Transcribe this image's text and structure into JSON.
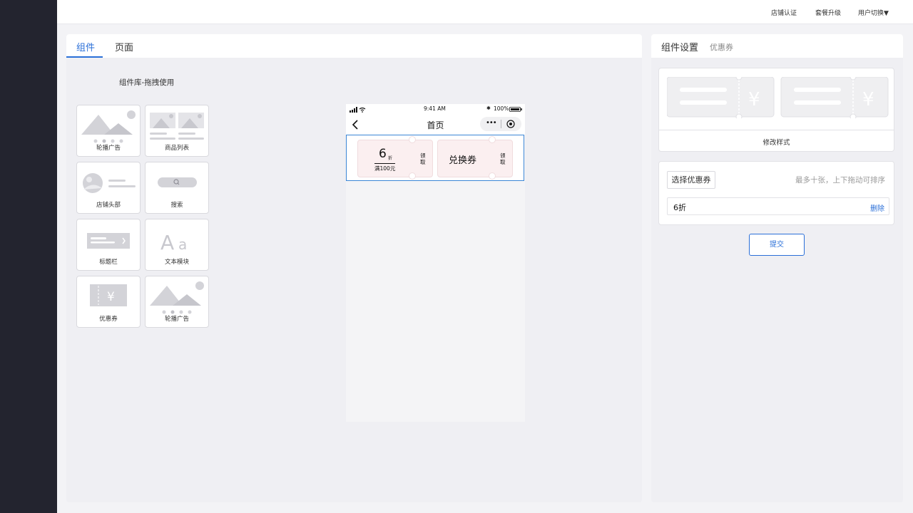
{
  "topbar": {
    "store_auth": "店铺认证",
    "plan_upgrade": "套餐升级",
    "user_switch": "用户切换▼"
  },
  "left_tabs": {
    "components": "组件",
    "page": "页面"
  },
  "library_title": "组件库-拖拽使用",
  "components": [
    {
      "label": "轮播广告",
      "icon": "banner-carousel-icon"
    },
    {
      "label": "商品列表",
      "icon": "product-list-icon"
    },
    {
      "label": "店铺头部",
      "icon": "store-header-icon"
    },
    {
      "label": "搜索",
      "icon": "search-bar-icon"
    },
    {
      "label": "标题栏",
      "icon": "title-bar-icon"
    },
    {
      "label": "文本模块",
      "icon": "text-module-icon"
    },
    {
      "label": "优惠券",
      "icon": "coupon-icon"
    },
    {
      "label": "轮播广告",
      "icon": "banner-carousel-icon"
    }
  ],
  "phone": {
    "status_time": "9:41 AM",
    "battery": "100%",
    "nav_title": "首页",
    "coupon1": {
      "discount": "6",
      "unit": "折",
      "condition": "满100元",
      "claim": "领取"
    },
    "coupon2": {
      "title": "兑换券",
      "claim": "领取"
    }
  },
  "right_tabs": {
    "settings": "组件设置",
    "coupon": "优惠券"
  },
  "style_section": {
    "modify_style": "修改样式",
    "yen": "¥"
  },
  "coupon_select": {
    "button": "选择优惠券",
    "hint": "最多十张，上下拖动可排序",
    "item_name": "6折",
    "delete": "删除"
  },
  "submit": "提交",
  "colors": {
    "accent": "#2a6fd8",
    "sidebar": "#23242f",
    "selection": "#3b86d6",
    "coupon_bg": "#fbeff0"
  }
}
